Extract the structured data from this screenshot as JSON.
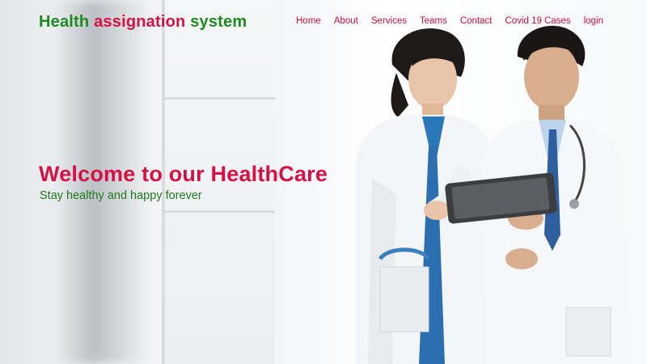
{
  "brand": {
    "part1": "Health ",
    "part2": "assignation",
    "part3": " system"
  },
  "nav": {
    "items": [
      {
        "label": "Home"
      },
      {
        "label": "About"
      },
      {
        "label": "Services"
      },
      {
        "label": "Teams"
      },
      {
        "label": "Contact"
      },
      {
        "label": "Covid 19 Cases"
      },
      {
        "label": "login"
      }
    ]
  },
  "hero": {
    "title": "Welcome to our HealthCare",
    "subtitle": "Stay healthy and happy forever"
  },
  "colors": {
    "accent_red": "#d31144",
    "accent_green": "#1e8a22"
  }
}
